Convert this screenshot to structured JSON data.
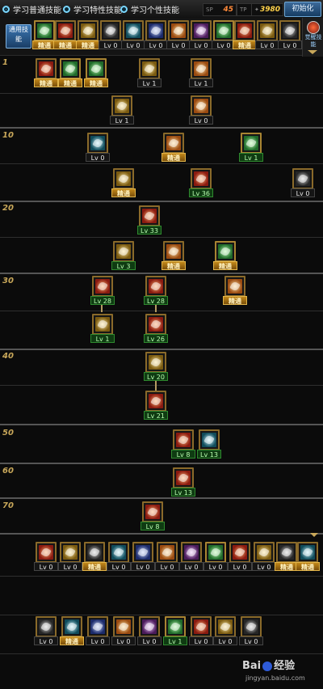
{
  "tabs": [
    {
      "label": "学习普通技能",
      "selected": true
    },
    {
      "label": "学习特性技能",
      "selected": false
    },
    {
      "label": "学习个性技能",
      "selected": false
    }
  ],
  "stats": {
    "sp_label": "SP",
    "sp_value": "45",
    "tp_label": "TP",
    "tp_value": "1",
    "gold_value": "3980"
  },
  "init_button": "初始化",
  "common_label": "通用技能",
  "side_label": "觉醒技能",
  "level_labels": [
    "1",
    "10",
    "20",
    "30",
    "40",
    "50",
    "60",
    "70"
  ],
  "common_skills": [
    {
      "label": "精通",
      "icon": "common-skill-icon"
    },
    {
      "label": "精通",
      "icon": "common-skill-icon"
    },
    {
      "label": "精通",
      "icon": "common-skill-icon"
    },
    {
      "label": "Lv 0",
      "icon": "common-skill-icon"
    },
    {
      "label": "Lv 0",
      "icon": "common-skill-icon"
    },
    {
      "label": "Lv 0",
      "icon": "common-skill-icon"
    },
    {
      "label": "Lv 0",
      "icon": "common-skill-icon"
    },
    {
      "label": "Lv 0",
      "icon": "common-skill-icon"
    },
    {
      "label": "Lv 0",
      "icon": "common-skill-icon"
    },
    {
      "label": "精通",
      "icon": "common-skill-icon"
    },
    {
      "label": "Lv 0",
      "icon": "common-skill-icon"
    },
    {
      "label": "Lv 0",
      "icon": "common-skill-icon"
    }
  ],
  "tree_skills": [
    {
      "label": "精通",
      "style": "jing",
      "icon": "skill-icon"
    },
    {
      "label": "精通",
      "style": "jing",
      "icon": "skill-icon"
    },
    {
      "label": "精通",
      "style": "jing",
      "icon": "skill-icon"
    },
    {
      "label": "Lv 1",
      "style": "lv",
      "icon": "skill-icon"
    },
    {
      "label": "Lv 1",
      "style": "lv",
      "icon": "skill-icon"
    },
    {
      "label": "Lv 1",
      "style": "lv",
      "icon": "skill-icon"
    },
    {
      "label": "Lv 0",
      "style": "lv",
      "icon": "skill-icon"
    },
    {
      "label": "Lv 0",
      "style": "lv",
      "icon": "skill-icon"
    },
    {
      "label": "精通",
      "style": "jing",
      "icon": "skill-icon"
    },
    {
      "label": "Lv 1",
      "style": "green",
      "icon": "skill-icon"
    },
    {
      "label": "精通",
      "style": "jing",
      "icon": "skill-icon"
    },
    {
      "label": "Lv 36",
      "style": "green",
      "icon": "skill-icon"
    },
    {
      "label": "Lv 0",
      "style": "lv",
      "icon": "skill-icon"
    },
    {
      "label": "Lv 33",
      "style": "green",
      "icon": "skill-icon"
    },
    {
      "label": "Lv 3",
      "style": "green",
      "icon": "skill-icon"
    },
    {
      "label": "精通",
      "style": "jing",
      "icon": "skill-icon"
    },
    {
      "label": "精通",
      "style": "jing",
      "icon": "skill-icon"
    },
    {
      "label": "Lv 28",
      "style": "green",
      "icon": "skill-icon"
    },
    {
      "label": "Lv 28",
      "style": "green",
      "icon": "skill-icon"
    },
    {
      "label": "精通",
      "style": "jing",
      "icon": "skill-icon"
    },
    {
      "label": "Lv 1",
      "style": "green",
      "icon": "skill-icon"
    },
    {
      "label": "Lv 26",
      "style": "green",
      "icon": "skill-icon"
    },
    {
      "label": "Lv 20",
      "style": "green",
      "icon": "skill-icon"
    },
    {
      "label": "Lv 21",
      "style": "green",
      "icon": "skill-icon"
    },
    {
      "label": "Lv 8",
      "style": "green",
      "icon": "skill-icon"
    },
    {
      "label": "Lv 13",
      "style": "green",
      "icon": "skill-icon"
    },
    {
      "label": "Lv 13",
      "style": "green",
      "icon": "skill-icon"
    },
    {
      "label": "Lv 8",
      "style": "green",
      "icon": "skill-icon"
    }
  ],
  "bottom_row1": [
    {
      "label": "Lv 0"
    },
    {
      "label": "Lv 0"
    },
    {
      "label": "精通"
    },
    {
      "label": "Lv 0"
    },
    {
      "label": "Lv 0"
    },
    {
      "label": "Lv 0"
    },
    {
      "label": "Lv 0"
    },
    {
      "label": "Lv 0"
    },
    {
      "label": "Lv 0"
    },
    {
      "label": "Lv 0"
    },
    {
      "label": "精通"
    },
    {
      "label": "精通"
    }
  ],
  "bottom_row2": [
    {
      "label": "Lv 0"
    },
    {
      "label": "精通"
    },
    {
      "label": "Lv 0"
    },
    {
      "label": "Lv 0"
    },
    {
      "label": "Lv 0"
    },
    {
      "label": "Lv 1"
    },
    {
      "label": "Lv 0"
    },
    {
      "label": "Lv 0"
    },
    {
      "label": "Lv 0"
    }
  ],
  "watermark": {
    "brand_left": "Bai",
    "brand_right": "经验",
    "url": "jingyan.baidu.com"
  }
}
